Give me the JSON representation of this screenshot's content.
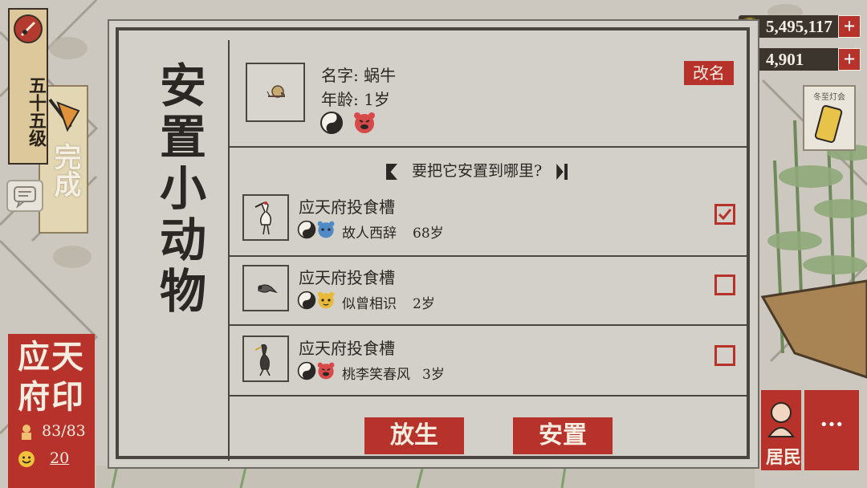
{
  "player": {
    "level_label": "五十五级",
    "quest_done_label": "完成"
  },
  "seal": {
    "name": "应天府印",
    "stat1": "83/83",
    "stat2": "20"
  },
  "currency": {
    "coins": "5,495,117",
    "gems": "4,901"
  },
  "event_banner": "冬至灯会",
  "residents_btn_label": "居民",
  "more_btn_label": "···",
  "dialog": {
    "title": "安置小动物",
    "pet": {
      "name": "名字: 蜗牛",
      "age": "年龄: 1岁"
    },
    "rename_label": "改名",
    "question": "要把它安置到哪里?",
    "slots": [
      {
        "location": "应天府投食槽",
        "animal": "故人西辞",
        "age": "68岁",
        "checked": true
      },
      {
        "location": "应天府投食槽",
        "animal": "似曾相识",
        "age": "2岁",
        "checked": false
      },
      {
        "location": "应天府投食槽",
        "animal": "桃李笑春风",
        "age": "3岁",
        "checked": false
      }
    ],
    "release_label": "放生",
    "place_label": "安置"
  },
  "colors": {
    "accent_red": "#b7322a",
    "paper": "#d3d0ca",
    "ink": "#2b2724"
  }
}
